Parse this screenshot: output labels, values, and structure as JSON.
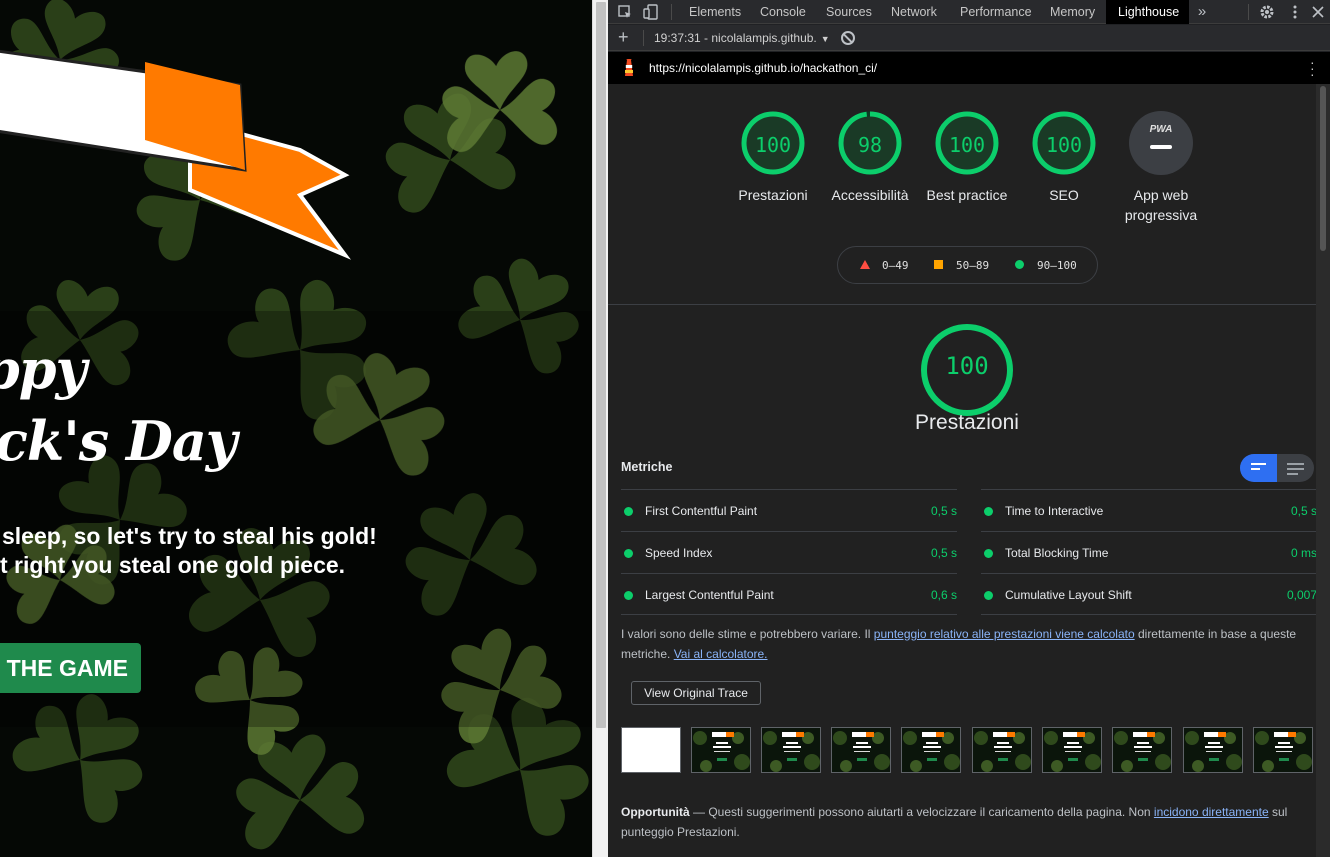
{
  "page": {
    "title_line1": "appy",
    "title_line2": "rick's Day",
    "subtitle_line1": "sleep, so let's try to steal his gold!",
    "subtitle_line2": "t right you steal one gold piece.",
    "start_button": "T THE GAME"
  },
  "devtools": {
    "tabs": [
      "Elements",
      "Console",
      "Sources",
      "Network",
      "Performance",
      "Memory",
      "Lighthouse"
    ],
    "active_tab": "Lighthouse",
    "more_tabs_icon": "»",
    "settings_icon": "gear-icon",
    "report_select": "19:37:31 - nicolalampis.github.",
    "url": "https://nicolalampis.github.io/hackathon_ci/"
  },
  "lighthouse": {
    "scores": [
      {
        "label": "Prestazioni",
        "score": "100"
      },
      {
        "label": "Accessibilità",
        "score": "98"
      },
      {
        "label": "Best practice",
        "score": "100"
      },
      {
        "label": "SEO",
        "score": "100"
      }
    ],
    "pwa_badge": "PWA",
    "pwa_label_line1": "App web",
    "pwa_label_line2": "progressiva",
    "legend": {
      "fail": "0–49",
      "average": "50–89",
      "pass": "90–100"
    },
    "perf_score": "100",
    "perf_title": "Prestazioni",
    "metrics_title": "Metriche",
    "metrics": [
      {
        "name": "First Contentful Paint",
        "value": "0,5 s"
      },
      {
        "name": "Time to Interactive",
        "value": "0,5 s"
      },
      {
        "name": "Speed Index",
        "value": "0,5 s"
      },
      {
        "name": "Total Blocking Time",
        "value": "0 ms"
      },
      {
        "name": "Largest Contentful Paint",
        "value": "0,6 s"
      },
      {
        "name": "Cumulative Layout Shift",
        "value": "0,007"
      }
    ],
    "note_text1": "I valori sono delle stime e potrebbero variare. Il ",
    "note_link1": "punteggio relativo alle prestazioni viene calcolato",
    "note_text2": " direttamente in base a queste metriche. ",
    "note_link2": "Vai al calcolatore.",
    "trace_button": "View Original Trace",
    "opp_title": "Opportunità",
    "opp_text1": " — Questi suggerimenti possono aiutarti a velocizzare il caricamento della pagina. Non ",
    "opp_link": "incidono direttamente",
    "opp_text2": " sul punteggio Prestazioni.",
    "colors": {
      "pass": "#0cce6b",
      "average": "#ffa400",
      "fail": "#ff4e42",
      "accent": "#2e6ff2"
    }
  }
}
